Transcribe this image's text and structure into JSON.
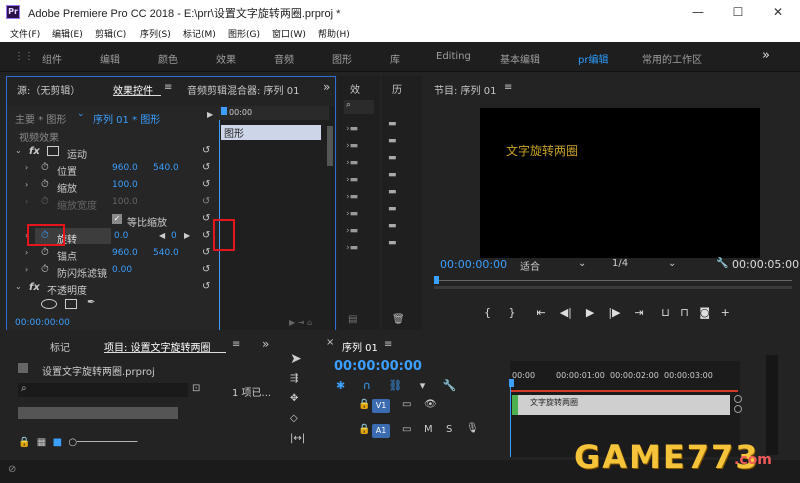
{
  "window": {
    "title": "Adobe Premiere Pro CC 2018 - E:\\prr\\设置文字旋转两圈.prproj *",
    "app_icon": "Pr",
    "controls": {
      "minimize": "—",
      "maximize": "☐",
      "close": "✕"
    }
  },
  "menu": [
    "文件(F)",
    "编辑(E)",
    "剪辑(C)",
    "序列(S)",
    "标记(M)",
    "图形(G)",
    "窗口(W)",
    "帮助(H)"
  ],
  "workspaces": {
    "items": [
      "组件",
      "编辑",
      "颜色",
      "效果",
      "音频",
      "图形",
      "库",
      "Editing",
      "基本编辑",
      "pr编辑",
      "常用的工作区"
    ],
    "active": "pr编辑",
    "more": "»"
  },
  "effect_controls": {
    "tabs": {
      "source": "源:（无剪辑）",
      "effect_controls": "效果控件",
      "audio_mixer": "音频剪辑混合器: 序列 01"
    },
    "master": "主要 * 图形",
    "sequence": "序列 01 * 图形",
    "timecode_top": "00:00",
    "video_effects_label": "视频效果",
    "clip_label": "图形",
    "motion": "运动",
    "position_label": "位置",
    "position_x": "960.0",
    "position_y": "540.0",
    "scale_label": "缩放",
    "scale_value": "100.0",
    "scale_width_label": "缩放宽度",
    "scale_width_value": "100.0",
    "uniform_scale_label": "等比缩放",
    "rotation_label": "旋转",
    "rotation_value": "0.0",
    "rotation_kf_value": "0",
    "anchor_label": "锚点",
    "anchor_x": "960.0",
    "anchor_y": "540.0",
    "flicker_label": "防闪烁滤镜",
    "flicker_value": "0.00",
    "opacity_label": "不透明度",
    "timecode_bottom": "00:00:00:00"
  },
  "mini_panels": {
    "effects_tab": "效",
    "history_tab": "历"
  },
  "program_monitor": {
    "title": "节目: 序列 01",
    "overlay_text": "文字旋转两圈",
    "timecode": "00:00:00:00",
    "fit": "适合",
    "resolution": "1/4",
    "duration": "00:00:05:00"
  },
  "project": {
    "tab_markers": "标记",
    "tab_project": "项目: 设置文字旋转两圈",
    "file_name": "设置文字旋转两圈.prproj",
    "item_count": "1 项已..."
  },
  "timeline": {
    "title": "序列 01",
    "timecode": "00:00:00:00",
    "ruler": [
      "00:00",
      "00:00:01:00",
      "00:00:02:00",
      "00:00:03:00"
    ],
    "track_v1": "V1",
    "track_a1": "A1",
    "mute": "M",
    "solo": "S",
    "clip_label": "文字旋转两圈"
  },
  "watermark": {
    "text": "GAME773",
    "suffix": ".com"
  },
  "colors": {
    "accent": "#2e9cff",
    "highlight_box": "#e8161c",
    "overlay_text": "#c9a227",
    "clip": "#4caf50"
  }
}
